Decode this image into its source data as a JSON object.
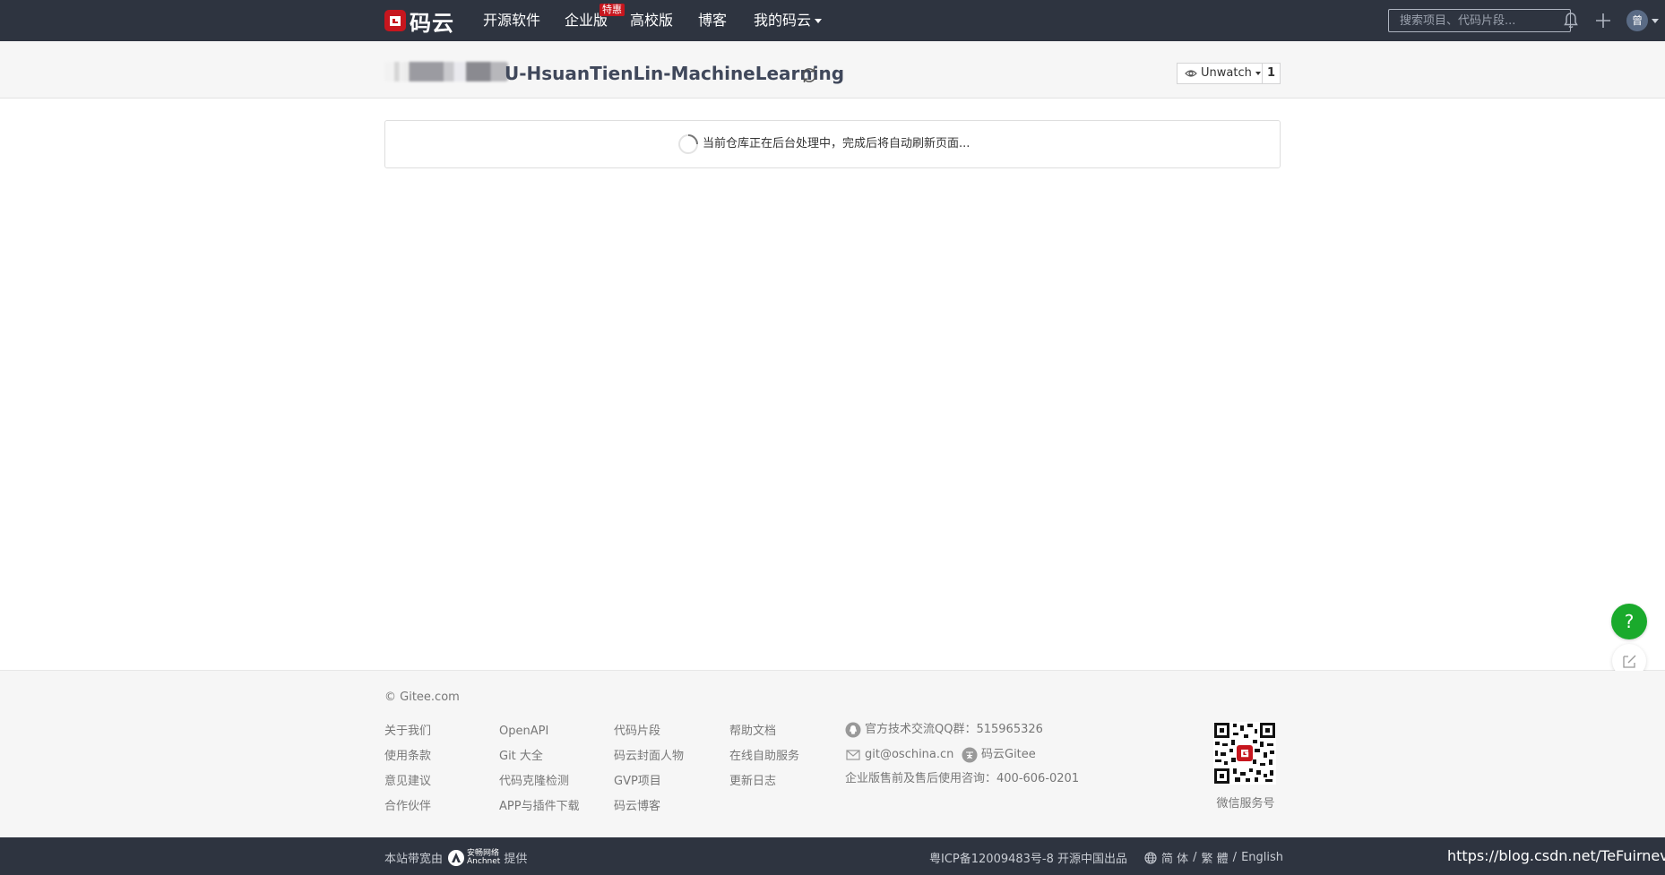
{
  "nav": {
    "logo_text": "码云",
    "items": [
      {
        "label": "开源软件"
      },
      {
        "label": "企业版",
        "badge": "特惠"
      },
      {
        "label": "高校版"
      },
      {
        "label": "博客"
      },
      {
        "label": "我的码云"
      }
    ],
    "search_placeholder": "搜索项目、代码片段...",
    "avatar_text": "曾",
    "icons": [
      "bell-icon",
      "plus-icon",
      "avatar"
    ]
  },
  "project": {
    "name_suffix": "U-HsuanTienLin-MachineLearning",
    "watch_label": "Unwatch",
    "watch_count": "1"
  },
  "main": {
    "message": "当前仓库正在后台处理中，完成后将自动刷新页面..."
  },
  "floating": {
    "help_label": "?"
  },
  "footer": {
    "copyright": "© Gitee.com",
    "columns": [
      [
        "关于我们",
        "使用条款",
        "意见建议",
        "合作伙伴"
      ],
      [
        "OpenAPI",
        "Git 大全",
        "代码克隆检测",
        "APP与插件下载"
      ],
      [
        "代码片段",
        "码云封面人物",
        "GVP项目",
        "码云博客"
      ],
      [
        "帮助文档",
        "在线自助服务",
        "更新日志"
      ]
    ],
    "qq_group": "官方技术交流QQ群：515965326",
    "email": "git@oschina.cn",
    "zhihu": "码云Gitee",
    "consult": "企业版售前及售后使用咨询：400-606-0201",
    "qr_label": "微信服务号"
  },
  "bottom": {
    "host_prefix": "本站带宽由",
    "anchnet_cn": "安畅网络",
    "anchnet_en": "Anchnet",
    "host_suffix": "提供",
    "icp": "粤ICP备12009483号-8 开源中国出品",
    "lang_simplified": "简 体",
    "lang_traditional": "繁 體",
    "lang_english": "English",
    "lang_sep": "/",
    "watermark_url": "https://blog.csdn.net/TeFuirnever"
  },
  "colors": {
    "nav_bg": "#2e3440",
    "brand_red": "#c7161e",
    "help_green": "#1aaa2c"
  }
}
